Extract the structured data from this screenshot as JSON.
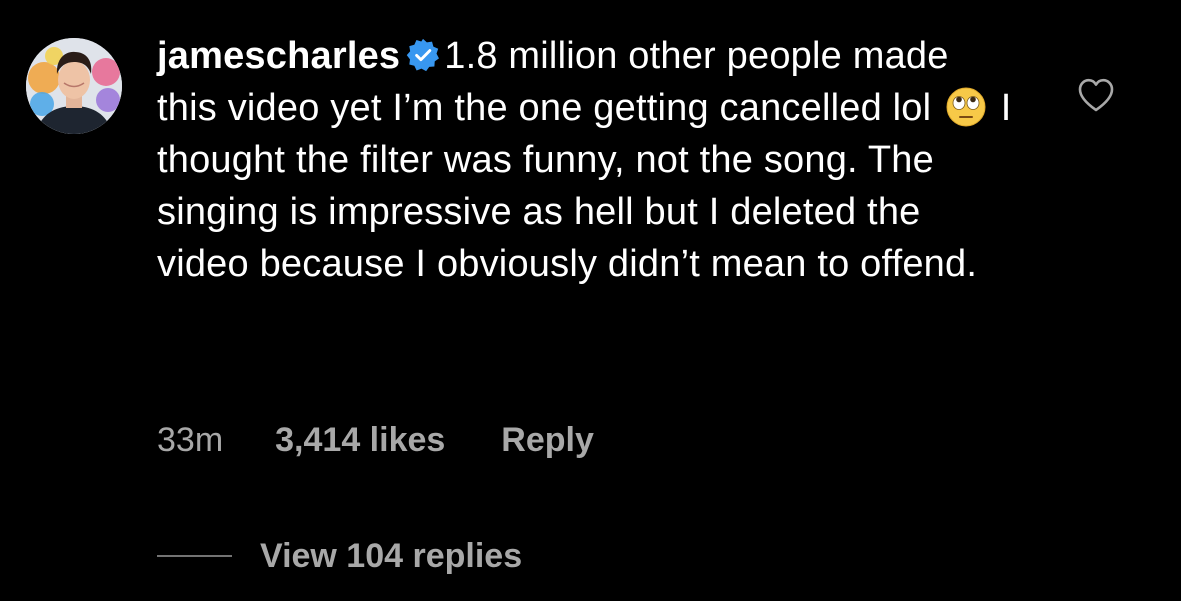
{
  "comment": {
    "username": "jamescharles",
    "verified": true,
    "text_part1": "1.8 million other people made this video yet I’m the one getting cancelled lol",
    "emoji": "face-with-rolling-eyes",
    "text_part2": "I thought the filter was funny, not the song. The singing is impressive as hell but I deleted the video because I obviously didn’t mean to offend.",
    "time_ago": "33m",
    "likes": "3,414 likes",
    "reply_label": "Reply",
    "view_replies_label": "View 104 replies"
  },
  "icons": {
    "avatar": "profile-avatar",
    "verified": "verified-badge-icon",
    "like": "heart-outline-icon"
  },
  "colors": {
    "background": "#000000",
    "text_primary": "#ffffff",
    "text_secondary": "#a8a8a8",
    "verified_blue": "#3897f0",
    "divider": "#737373"
  }
}
